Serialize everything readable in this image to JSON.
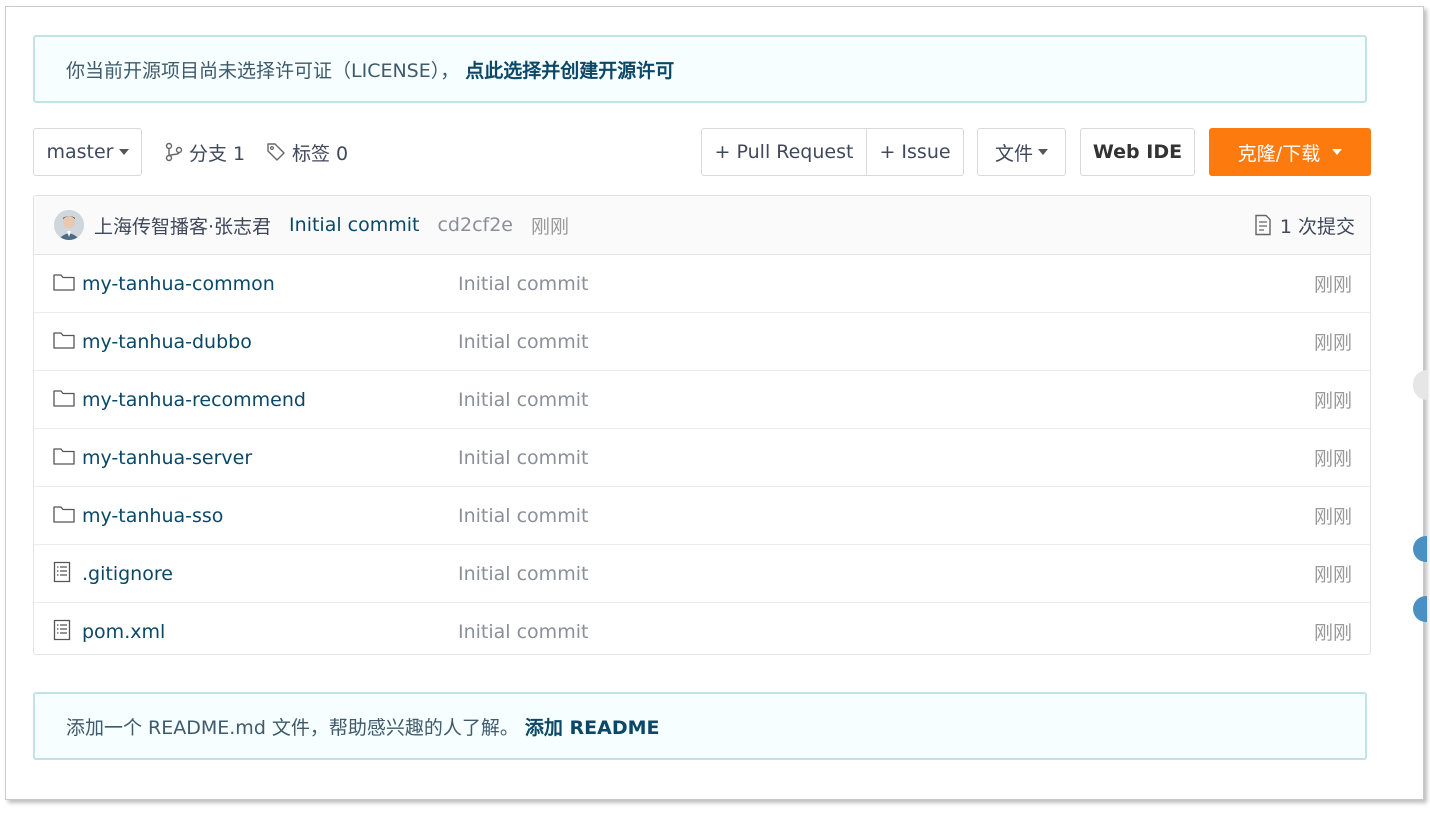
{
  "license_notice": {
    "text": "你当前开源项目尚未选择许可证（LICENSE），",
    "link": "点此选择并创建开源许可"
  },
  "toolbar": {
    "branch": "master",
    "branches_label": "分支 1",
    "tags_label": "标签 0",
    "pull_request": "+ Pull Request",
    "issue": "+ Issue",
    "file_menu": "文件",
    "web_ide": "Web IDE",
    "clone_download": "克隆/下载"
  },
  "latest_commit": {
    "author": "上海传智播客·张志君",
    "message": "Initial commit",
    "sha": "cd2cf2e",
    "time": "刚刚",
    "commits_count": "1 次提交"
  },
  "files": [
    {
      "type": "folder",
      "name": "my-tanhua-common",
      "message": "Initial commit",
      "time": "刚刚"
    },
    {
      "type": "folder",
      "name": "my-tanhua-dubbo",
      "message": "Initial commit",
      "time": "刚刚"
    },
    {
      "type": "folder",
      "name": "my-tanhua-recommend",
      "message": "Initial commit",
      "time": "刚刚"
    },
    {
      "type": "folder",
      "name": "my-tanhua-server",
      "message": "Initial commit",
      "time": "刚刚"
    },
    {
      "type": "folder",
      "name": "my-tanhua-sso",
      "message": "Initial commit",
      "time": "刚刚"
    },
    {
      "type": "file",
      "name": ".gitignore",
      "message": "Initial commit",
      "time": "刚刚"
    },
    {
      "type": "file",
      "name": "pom.xml",
      "message": "Initial commit",
      "time": "刚刚"
    }
  ],
  "readme_notice": {
    "text": "添加一个 README.md 文件，帮助感兴趣的人了解。",
    "link": "添加 README"
  },
  "colors": {
    "clone_button": "#fd7a0f",
    "link": "#0b4867",
    "notice_bg": "#f6feff",
    "notice_border": "#c2e2e7"
  }
}
